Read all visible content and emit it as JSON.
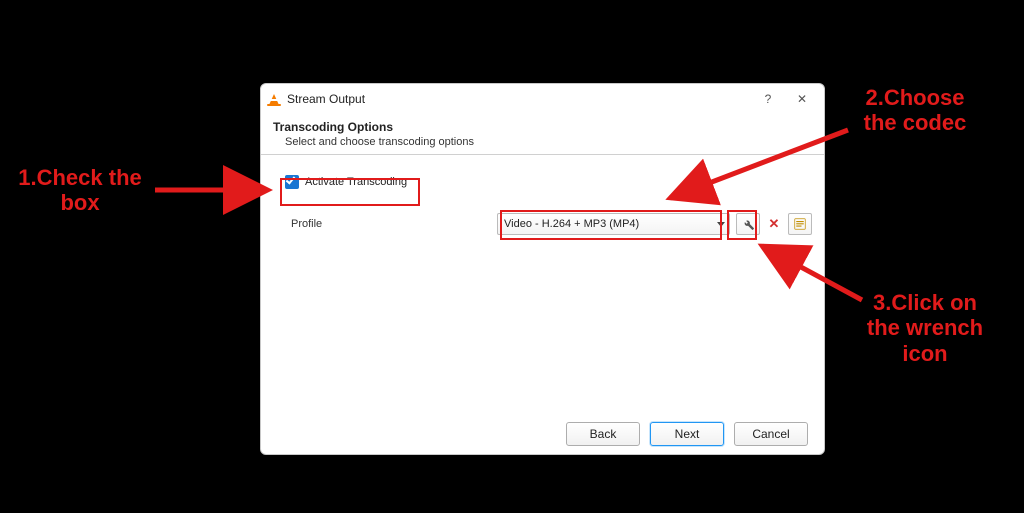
{
  "window": {
    "title": "Stream Output",
    "help_symbol": "?",
    "close_symbol": "✕"
  },
  "section": {
    "title": "Transcoding Options",
    "subtitle": "Select and choose transcoding options"
  },
  "activate": {
    "label": "Activate Transcoding",
    "checked": true
  },
  "profile": {
    "label": "Profile",
    "selected": "Video - H.264 + MP3 (MP4)"
  },
  "icons": {
    "wrench": "wrench-icon",
    "delete": "✕",
    "new": "new-profile-icon"
  },
  "footer": {
    "back": "Back",
    "next": "Next",
    "cancel": "Cancel"
  },
  "annotations": {
    "step1_line1": "1.Check the",
    "step1_line2": "box",
    "step2_line1": "2.Choose",
    "step2_line2": "the codec",
    "step3_line1": "3.Click on",
    "step3_line2": "the wrench",
    "step3_line3": "icon"
  }
}
